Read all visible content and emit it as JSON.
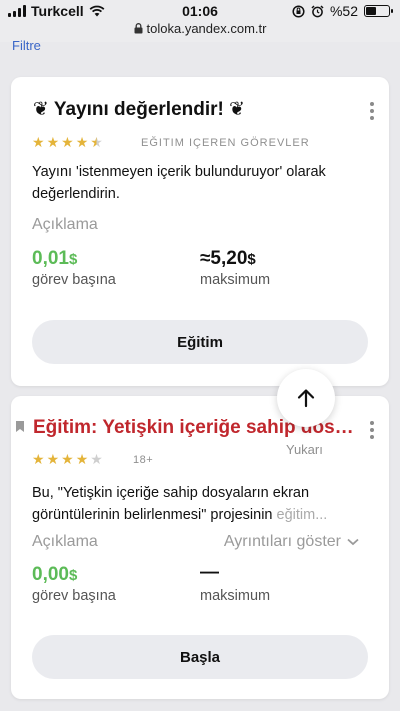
{
  "status_bar": {
    "carrier": "Turkcell",
    "time": "01:06",
    "battery": "%52",
    "battery_level": 0.52
  },
  "browser": {
    "url": "toloka.yandex.com.tr"
  },
  "filter_link": "Filtre",
  "tasks": [
    {
      "title": "❦ Yayını değerlendir! ❦",
      "rating": 4.5,
      "tag": "EĞITIM IÇEREN GÖREVLER",
      "description": "Yayını 'istenmeyen içerik bulunduruyor' olarak değerlendirin.",
      "description_label": "Açıklama",
      "price": "0,01",
      "price_currency": "$",
      "price_caption": "görev başına",
      "max": "≈5,20",
      "max_currency": "$",
      "max_caption": "maksimum",
      "action": "Eğitim"
    },
    {
      "title": "Eğitim: Yetişkin içeriğe sahip dosyal..",
      "rating": 4,
      "tag": "18+",
      "description": "Bu, \"Yetişkin içeriğe sahip dosyaların ekran görüntülerinin belirlenmesi\" projesinin",
      "description_fade": "eğitim...",
      "description_label": "Açıklama",
      "details_toggle": "Ayrıntıları göster",
      "price": "0,00",
      "price_currency": "$",
      "price_caption": "görev başına",
      "max": "—",
      "max_caption": "maksimum",
      "action": "Başla"
    }
  ],
  "scroll_up": {
    "label": "Yukarı"
  },
  "colors": {
    "accent_green": "#5cbb57",
    "title_red": "#c0272d",
    "link_blue": "#3b67c8",
    "star": "#e4b43a"
  }
}
